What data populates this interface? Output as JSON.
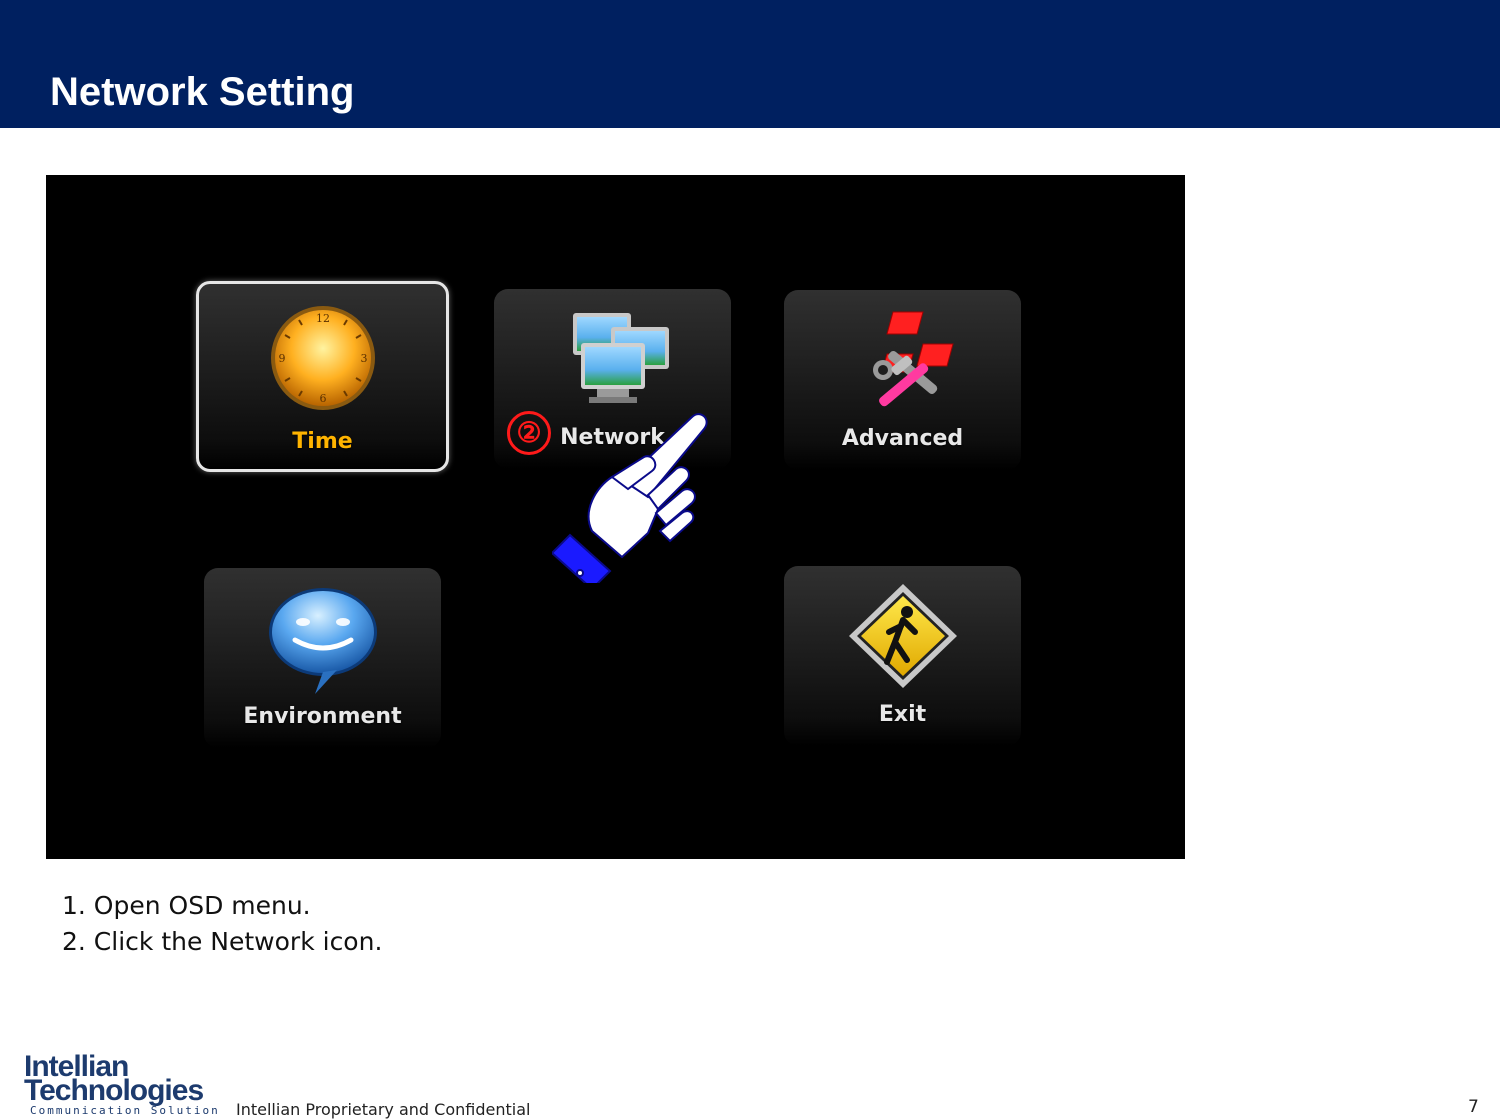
{
  "header": {
    "title": "Network Setting"
  },
  "osd_menu": {
    "tiles": [
      {
        "label": "Time",
        "icon": "clock-icon",
        "selected": true
      },
      {
        "label": "Network",
        "icon": "network-computers-icon",
        "selected": false
      },
      {
        "label": "Advanced",
        "icon": "tools-icon",
        "selected": false
      },
      {
        "label": "Environment",
        "icon": "speech-bubble-icon",
        "selected": false
      },
      {
        "label": "Exit",
        "icon": "pedestrian-warning-icon",
        "selected": false
      }
    ],
    "step_marker": "②",
    "pointer_icon": "pointing-hand-icon"
  },
  "instructions": [
    "1. Open OSD menu.",
    "2. Click the Network icon."
  ],
  "footer": {
    "logo_line1": "Intellian",
    "logo_line2": "Technologies",
    "logo_tagline": "Communication Solution",
    "confidential": "Intellian Proprietary and Confidential",
    "page_number": "7"
  },
  "colors": {
    "header_bg": "#002060",
    "screen_bg": "#000000",
    "selected_label": "#ffb400",
    "marker": "#ff1a1a",
    "hand_fill": "#1a1aff"
  }
}
